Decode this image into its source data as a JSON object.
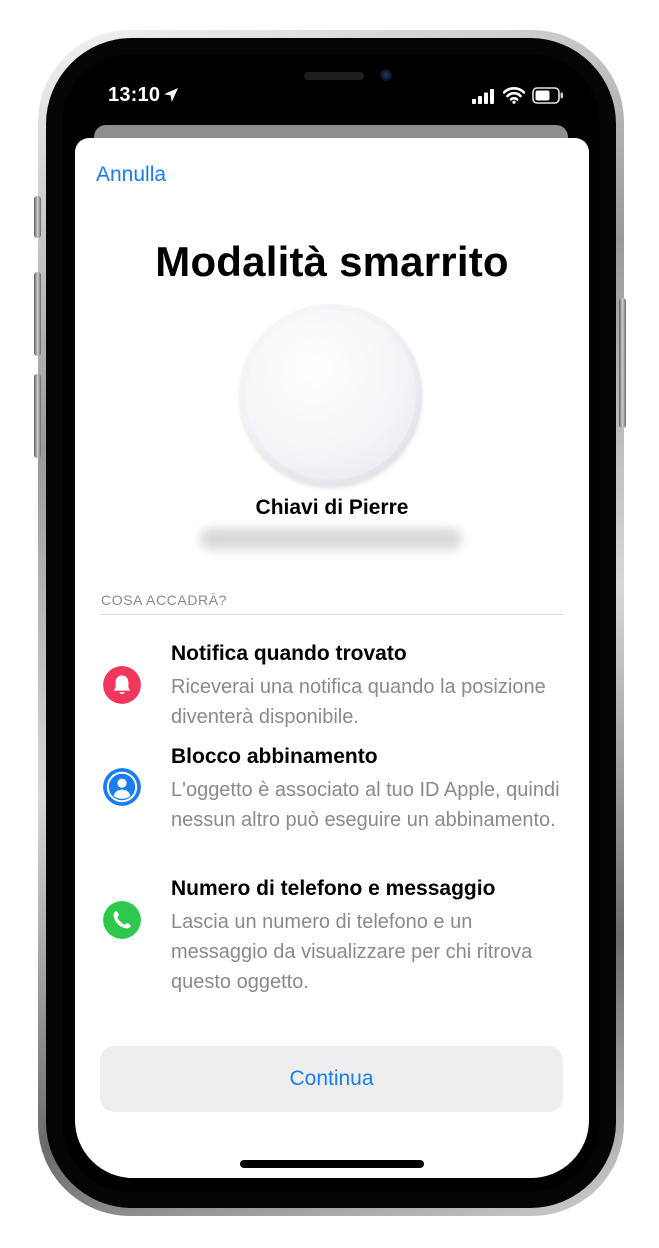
{
  "status_bar": {
    "time": "13:10",
    "icons": [
      "location-arrow-icon",
      "cellular-signal-icon",
      "wifi-icon",
      "battery-icon"
    ]
  },
  "sheet": {
    "cancel_label": "Annulla",
    "title": "Modalità smarrito",
    "item_image": "airtag-icon",
    "item_name": "Chiavi di Pierre",
    "section_header": "COSA ACCADRÀ?",
    "features": [
      {
        "icon": "bell-icon",
        "icon_color": "#f3365b",
        "title": "Notifica quando trovato",
        "description": "Riceverai una notifica quando la posizione diventerà disponibile."
      },
      {
        "icon": "person-icon",
        "icon_color": "#1a7cf1",
        "title": "Blocco abbinamento",
        "description": "L'oggetto è associato al tuo ID Apple, quindi nessun altro può eseguire un abbinamento."
      },
      {
        "icon": "phone-icon",
        "icon_color": "#2fc84f",
        "title": "Numero di telefono e messaggio",
        "description": "Lascia un numero di telefono e un messaggio da visualizzare per chi ritrova questo oggetto."
      }
    ],
    "continue_label": "Continua"
  },
  "colors": {
    "accent": "#1a7cf1",
    "secondary_text": "#8a8a8e",
    "button_background": "#eeeef0"
  }
}
